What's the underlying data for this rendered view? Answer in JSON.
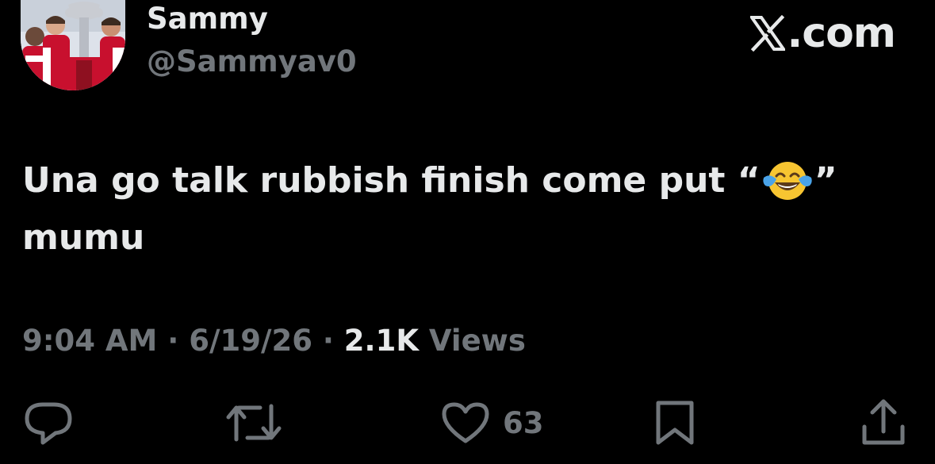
{
  "author": {
    "name": "Sammy",
    "handle": "@Sammyav0",
    "avatar_icon": "profile-photo"
  },
  "brand": {
    "logo_icon": "x-logo-icon",
    "text": ".com"
  },
  "tweet": {
    "text_part1": "Una go talk rubbish finish come put “",
    "emoji_icon": "face-with-tears-of-joy-emoji",
    "text_part2": "”\nmumu"
  },
  "meta": {
    "time": "9:04 AM",
    "separator": " · ",
    "date": "6/19/26",
    "views_count": "2.1K",
    "views_label": " Views"
  },
  "actions": {
    "reply_icon": "reply-icon",
    "retweet_icon": "retweet-icon",
    "like_icon": "heart-icon",
    "like_count": "63",
    "bookmark_icon": "bookmark-icon",
    "share_icon": "share-icon"
  },
  "colors": {
    "background": "#000000",
    "primary_text": "#e7e9ea",
    "secondary_text": "#71767b",
    "emoji_face": "#f7c531",
    "emoji_tears": "#4aa3e8"
  }
}
